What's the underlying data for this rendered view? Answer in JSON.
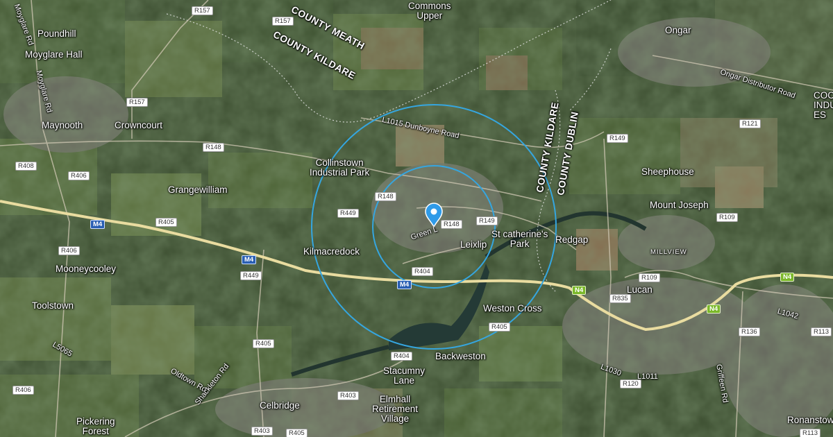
{
  "counties": {
    "meath": "COUNTY MEATH",
    "kildare_north": "COUNTY KILDARE",
    "kildare_east": "COUNTY KILDARE",
    "dublin": "COUNTY DUBLIN"
  },
  "places": {
    "commons_upper": "Commons\nUpper",
    "ongar": "Ongar",
    "poundhill": "Poundhill",
    "moyglare_hall": "Moyglare Hall",
    "maynooth": "Maynooth",
    "crowncourt": "Crowncourt",
    "collinstown": "Collinstown\nIndustrial Park",
    "grangewilliam": "Grangewilliam",
    "sheephouse": "Sheephouse",
    "mount_joseph": "Mount Joseph",
    "kilmacredock": "Kilmacredock",
    "leixlip": "Leixlip",
    "st_catherines": "St catherine's\nPark",
    "redgap": "Redgap",
    "millview": "MILLVIEW",
    "mooneycooley": "Mooneycooley",
    "lucan": "Lucan",
    "toolstown": "Toolstown",
    "weston_cross": "Weston Cross",
    "backweston": "Backweston",
    "stacumny": "Stacumny\nLane",
    "celbridge": "Celbridge",
    "elmhall": "Elmhall\nRetirement\nVillage",
    "pickering": "Pickering\nForest",
    "ronanstown": "Ronanstow",
    "coc": "COC\nINDU\nES"
  },
  "roads": {
    "dunboyne": "L1015 Dunboyne Road",
    "ongar_distributor": "Ongar Distributor Road",
    "moyglare_rd_top": "Moyglare Rd",
    "moyglare_rd": "Moyglare Rd",
    "green_lane": "Green L",
    "oldtown": "Oldtown Rd",
    "shackleton": "Shackleton Rd",
    "l5065": "L5065",
    "l1030": "L1030",
    "l1011": "L1011",
    "l1042": "L1042",
    "griffeen": "Griffeen Rd"
  },
  "shields": {
    "r157a": "R157",
    "r157b": "R157",
    "r157c": "R157",
    "r148a": "R148",
    "r148b": "R148",
    "r148c": "R148",
    "r408": "R408",
    "r406a": "R406",
    "r406b": "R406",
    "r406c": "R406",
    "r405a": "R405",
    "r405b": "R405",
    "r405c": "R405",
    "r405d": "R405",
    "r449a": "R449",
    "r449b": "R449",
    "r149a": "R149",
    "r149b": "R149",
    "r404a": "R404",
    "r404b": "R404",
    "r403a": "R403",
    "r403b": "R403",
    "r121": "R121",
    "r109a": "R109",
    "r109b": "R109",
    "r835": "R835",
    "r136": "R136",
    "r113a": "R113",
    "r113b": "R113",
    "r120": "R120",
    "m4a": "M4",
    "m4b": "M4",
    "m4c": "M4",
    "n4a": "N4",
    "n4b": "N4",
    "n4c": "N4"
  },
  "colors": {
    "radius_circle": "#35a6e0",
    "pin": "#2f9be8",
    "motorway": "#e9dca0"
  },
  "icons": {
    "marker": "map-pin-icon"
  }
}
